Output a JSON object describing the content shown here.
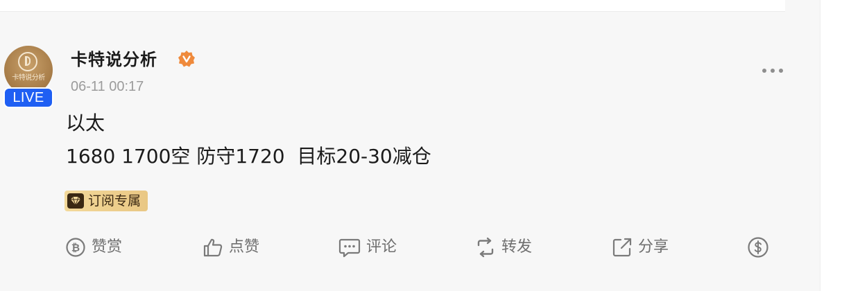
{
  "author": {
    "name": "卡特说分析",
    "avatar_text": "卡特说分析",
    "live_label": "LIVE",
    "verified_icon": "verified-badge-icon"
  },
  "post": {
    "timestamp": "06-11 00:17",
    "line1": "以太",
    "line2": "1680 1700空 防守1720  目标20-30减仓",
    "badge_label": "订阅专属"
  },
  "actions": {
    "reward": "赞赏",
    "like": "点赞",
    "comment": "评论",
    "repost": "转发",
    "share": "分享"
  },
  "colors": {
    "live": "#1f5ff3",
    "verified": "#ef8a3c",
    "badge_gold": "#f3d99a"
  }
}
